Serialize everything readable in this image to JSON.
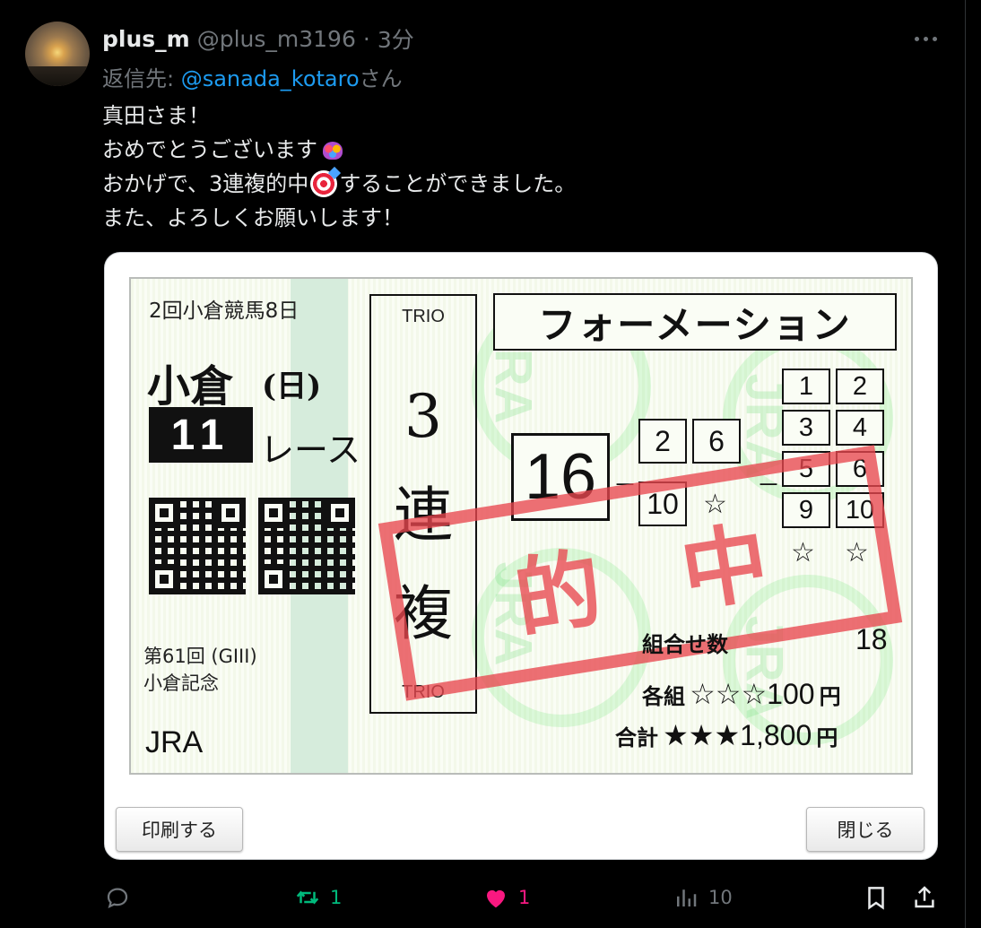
{
  "post": {
    "username": "plus_m",
    "handle": "@plus_m3196",
    "separator": "·",
    "time": "3分",
    "reply_prefix": "返信先: ",
    "reply_mention": "@sanada_kotaro",
    "reply_suffix": "さん",
    "text_lines": [
      "真田さま！",
      "おめでとうございます",
      "おかげで、3連複的中",
      "することができました。",
      "また、よろしくお願いします！"
    ]
  },
  "ticket": {
    "race_info": "2回小倉競馬8日",
    "venue": "小倉",
    "day": "(日)",
    "race_number": "11",
    "race_label": "レース",
    "event_line1": "第61回 (GIII)",
    "event_line2": "小倉記念",
    "org": "JRA",
    "bet_en_top": "TRIO",
    "bet_en_bottom": "TRIO",
    "bet_type_chars": [
      "3",
      "連",
      "複"
    ],
    "formation_title": "フォーメーション",
    "first_leg": "16",
    "second_leg": [
      "2",
      "6",
      "10",
      "☆"
    ],
    "third_leg": [
      "1",
      "2",
      "3",
      "4",
      "5",
      "6",
      "9",
      "10",
      "☆",
      "☆"
    ],
    "dash": "－",
    "stamp": [
      "的",
      "中"
    ],
    "combos_label": "組合せ数",
    "combos_value": "18",
    "each_label": "各組",
    "each_stars": "☆☆☆",
    "each_value": "100",
    "total_label": "合計",
    "total_stars": "★★★",
    "total_value": "1,800",
    "currency": "円",
    "watermark": "JRA"
  },
  "dialog": {
    "print_button": "印刷する",
    "close_button": "閉じる"
  },
  "actions": {
    "replies": "",
    "retweets": "1",
    "likes": "1",
    "views": "10"
  },
  "colors": {
    "background": "#000000",
    "handle_gray": "#71767b",
    "link_blue": "#1d9bf0",
    "retweet_green": "#00ba7c",
    "like_pink": "#f91880",
    "stamp_red": "#e8464e"
  }
}
